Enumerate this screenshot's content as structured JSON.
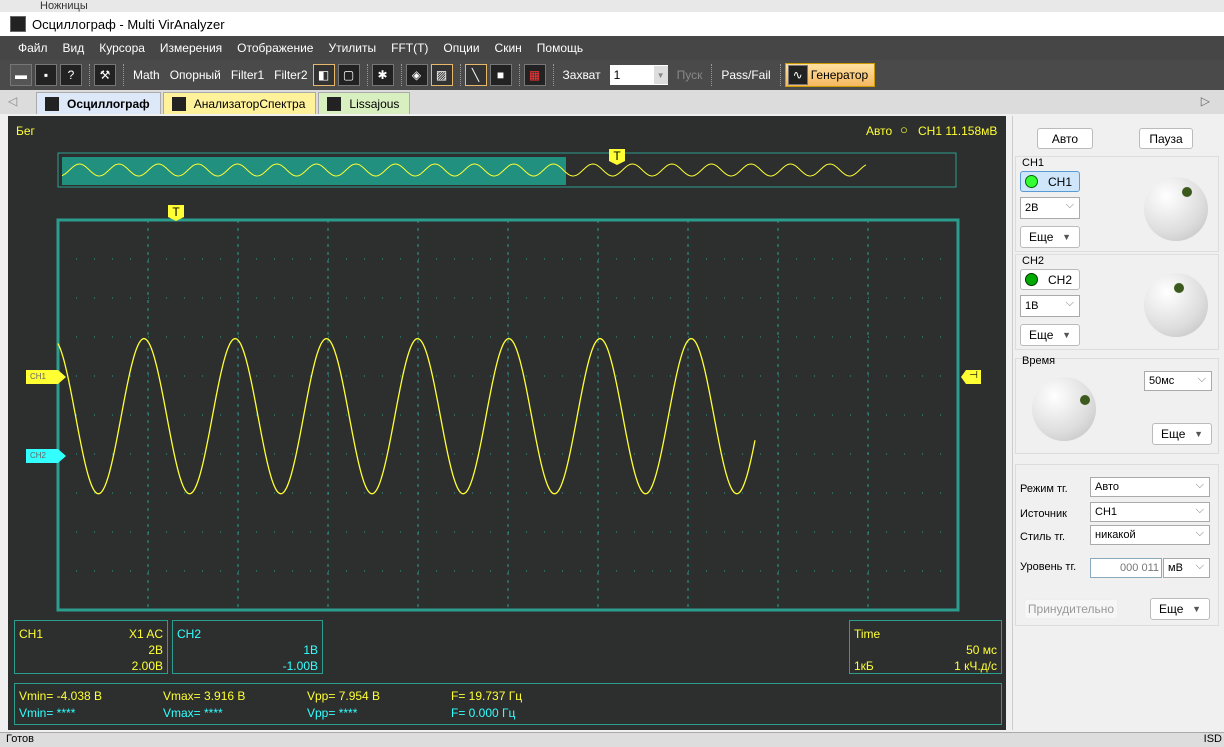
{
  "window": {
    "top_fragment": "Ножницы",
    "title": "Осциллограф - Multi VirAnalyzer"
  },
  "menu": [
    "Файл",
    "Вид",
    "Курсора",
    "Измерения",
    "Отображение",
    "Утилиты",
    "FFT(T)",
    "Опции",
    "Скин",
    "Помощь"
  ],
  "toolbar": {
    "math": "Math",
    "ref": "Опорный",
    "filter1": "Filter1",
    "filter2": "Filter2",
    "capture_label": "Захват",
    "capture_value": "1",
    "start": "Пуск",
    "passfail": "Pass/Fail",
    "generator": "Генератор",
    "help": "?"
  },
  "tabs": [
    {
      "label": "Осциллограф",
      "color": "#dde8f8"
    },
    {
      "label": "АнализаторСпектра",
      "color": "#fff29a"
    },
    {
      "label": "Lissajous",
      "color": "#d8efc0"
    }
  ],
  "scope": {
    "state": "Бег",
    "trigger_status": "Авто",
    "trigger_info": "CH1 11.158мВ",
    "ch1_marker": "CH1",
    "ch2_marker": "CH2",
    "trigger_marker": "T",
    "colors": {
      "ch1": "#ffff33",
      "ch2": "#33ffff",
      "grid": "#2a9d8f",
      "background": "#2d2f2f"
    },
    "signal": {
      "frequency_hz": 19.737,
      "vmax": 3.916,
      "vmin": -4.038,
      "time_div_ms": 50,
      "volt_div_v": 2
    }
  },
  "info": {
    "ch1": {
      "name": "CH1",
      "probe": "X1  AC",
      "vdiv": "2В",
      "offset": "2.00В"
    },
    "ch2": {
      "name": "CH2",
      "vdiv": "1В",
      "offset": "-1.00В"
    },
    "time": {
      "name": "Time",
      "tdiv": "50 мс",
      "mem": "1кБ",
      "rate": "1 кЧ.д/с"
    }
  },
  "measure": {
    "ch1": [
      "Vmin= -4.038 В",
      "Vmax= 3.916 В",
      "Vpp= 7.954 В",
      "F= 19.737 Гц"
    ],
    "ch2": [
      "Vmin= ****",
      "Vmax= ****",
      "Vpp= ****",
      "F= 0.000 Гц"
    ]
  },
  "panel": {
    "auto": "Авто",
    "pause": "Пауза",
    "ch1_group": "CH1",
    "ch1_btn": "CH1",
    "ch1_vdiv": "2В",
    "more": "Еще",
    "ch2_group": "CH2",
    "ch2_btn": "CH2",
    "ch2_vdiv": "1В",
    "time_group": "Время",
    "time_value": "50мс",
    "trig_mode_label": "Режим тг.",
    "trig_mode": "Авто",
    "trig_src_label": "Источник тг.",
    "trig_src": "CH1",
    "trig_style_label": "Стиль тг.",
    "trig_style": "никакой",
    "trig_level_label": "Уровень тг.",
    "trig_level": "000 011",
    "trig_unit": "мВ",
    "force": "Принудительно"
  },
  "status": {
    "left": "Готов",
    "right": "ISD"
  }
}
